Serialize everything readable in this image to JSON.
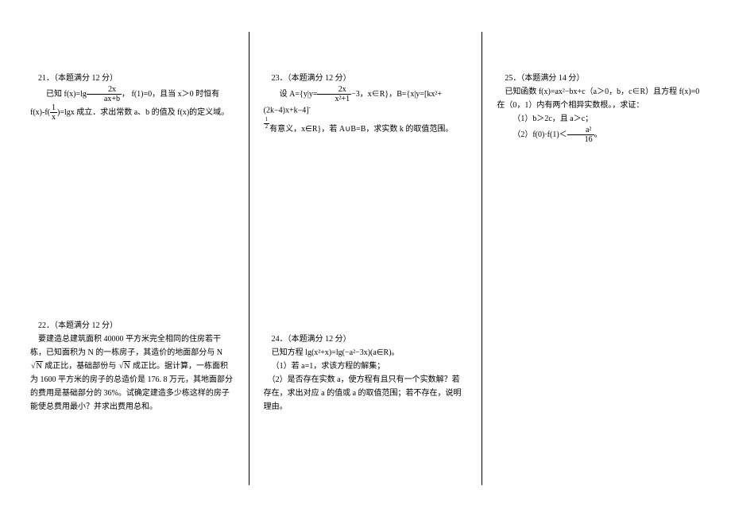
{
  "problems": {
    "p21": {
      "header": "21．（本题满分 12 分）",
      "prefix": "已知 f(x)=lg",
      "frac1_num": "2x",
      "frac1_den": "ax+b",
      "mid1": "， f(1)=0，且当 x＞0 时恒有",
      "line2a": "f(x)-f(",
      "frac2_num": "1",
      "frac2_den": "x",
      "line2b": ")=lgx 成立．求出常数 a、b 的值及 f(x)的定义域。"
    },
    "p22": {
      "header": "22．（本题满分 12 分）",
      "l1a": "要建造总建筑面积 40000 平方米完全相同的住房若干栋，已知面积为 N 的一栋房子，其造价的地面部分与 N",
      "sqrt1": "N",
      "l1b": " 成正比，基础部份与 ",
      "sqrt2": "N",
      "l1c": " 成正比。据计算，一栋面积为 1600 平方米的房子的总造价是 176. 8 万元，其地面部分的费用是基础部分的 36%。试确定建造多少栋这样的房子能使总费用最小？并求出费用总和。"
    },
    "p23": {
      "header": "23．（本题满分 12 分）",
      "l1a": "设 A={y|y=",
      "frac1_num": "2x",
      "frac1_den": "x²+1",
      "l1b": "−3，x∈R}，B={x|y=[kx²+(2k−4)x+k−4]",
      "exp_num": "1",
      "exp_den": "2",
      "l2": "有意义，x∈R}，若 A∪B=B，求实数 k 的取值范围。"
    },
    "p24": {
      "header": "24．（本题满分 12 分）",
      "l1": "已知方程 lg(x²+x)=lg(−a²−3x)(a∈R)。",
      "l2": "（1）若 a=1，求该方程的解集；",
      "l3": "（2）是否存在实数 a，使方程有且只有一个实数解？若存在，求出对应 a 的值或 a 的取值范围；若不存在，说明理由。"
    },
    "p25": {
      "header": "25．（本题满分 14 分）",
      "l1": "已知函数 f(x)=ax²−bx+c（a＞0，b，c∈R）且方程 f(x)=0 在（0，1）内有两个相异实数根。，求证：",
      "l2": "（1）b＞2c，且 a＞c；",
      "l3a": "（2）f(0)·f(1)＜",
      "frac_num": "a²",
      "frac_den": "16",
      "l3b": "。"
    }
  }
}
